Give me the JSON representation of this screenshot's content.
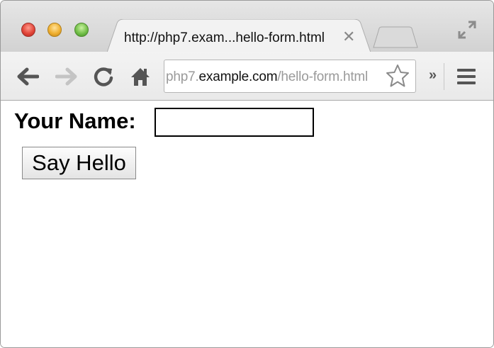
{
  "window": {
    "traffic_lights": [
      "close-button",
      "minimize-button",
      "maximize-button"
    ]
  },
  "tab": {
    "title": "http://php7.exam...hello-form.html",
    "close_glyph": "✕"
  },
  "toolbar": {
    "back_icon": "back-arrow-icon",
    "forward_icon": "forward-arrow-icon",
    "reload_icon": "reload-icon",
    "home_icon": "home-icon",
    "overflow_label": "»",
    "menu_icon": "hamburger-menu-icon"
  },
  "address_bar": {
    "prefix": "php7.",
    "host": "example.com",
    "path": "/hello-form.html",
    "bookmark_icon": "star-icon"
  },
  "form": {
    "name_label": "Your Name:",
    "name_value": "",
    "submit_label": "Say Hello"
  },
  "colors": {
    "chrome_bg": "#e0e0e0",
    "url_dim": "#9a9a9a",
    "close_red": "#e2463a",
    "minimize_yellow": "#f0b030",
    "maximize_green": "#74c04a"
  }
}
